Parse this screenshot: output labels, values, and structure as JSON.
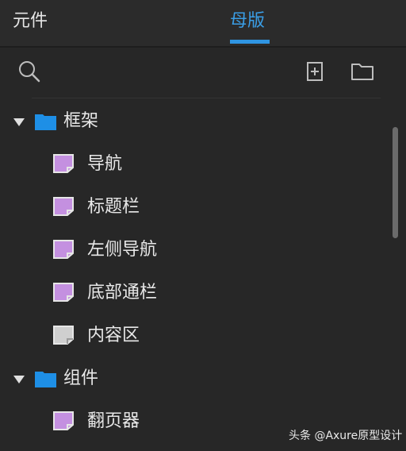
{
  "tabs": {
    "components": "元件",
    "masters": "母版",
    "active": "母版",
    "active_color": "#2f95e2"
  },
  "toolbar": {
    "icons": [
      "search-icon",
      "add-page-icon",
      "add-folder-icon"
    ]
  },
  "tree": {
    "folder_color": "#1e8fe6",
    "page_color_purple": "#c490e0",
    "page_color_gray": "#cfcfcf",
    "items": [
      {
        "type": "folder",
        "label": "框架",
        "expanded": true
      },
      {
        "type": "page",
        "label": "导航",
        "icon": "purple"
      },
      {
        "type": "page",
        "label": "标题栏",
        "icon": "purple"
      },
      {
        "type": "page",
        "label": "左侧导航",
        "icon": "purple"
      },
      {
        "type": "page",
        "label": "底部通栏",
        "icon": "purple"
      },
      {
        "type": "page",
        "label": "内容区",
        "icon": "gray"
      },
      {
        "type": "folder",
        "label": "组件",
        "expanded": true
      },
      {
        "type": "page",
        "label": "翻页器",
        "icon": "purple"
      }
    ]
  },
  "watermark": "头条 @Axure原型设计"
}
